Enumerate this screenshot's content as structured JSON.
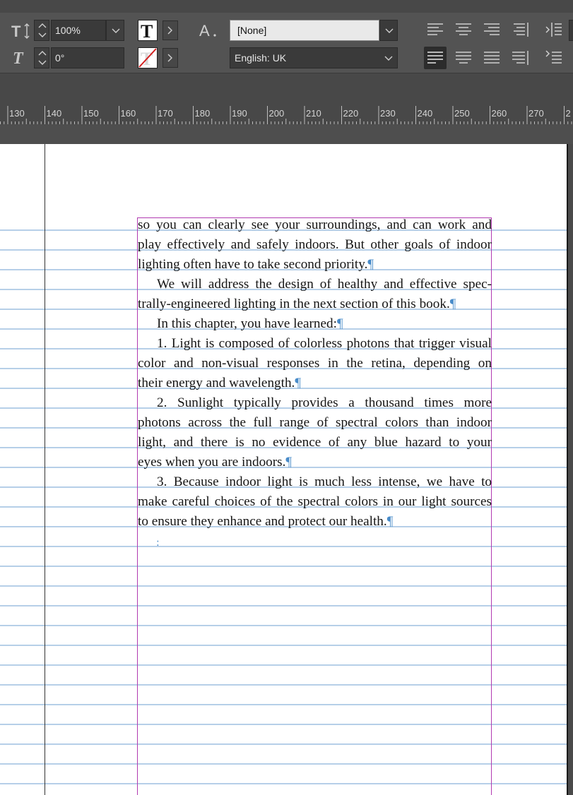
{
  "toolbar": {
    "horizontal_scale": "100%",
    "skew": "0°",
    "character_style": "[None]",
    "language": "English: UK"
  },
  "ruler": {
    "labels": [
      "130",
      "140",
      "150",
      "160",
      "170",
      "180",
      "190",
      "200",
      "210",
      "220",
      "230",
      "240",
      "250",
      "260",
      "270",
      "2"
    ]
  },
  "document": {
    "lines": [
      "so you can clearly see your surroundings, and can work and",
      "play effectively and safely indoors. But other goals of indoor",
      "lighting often have to take second priority.",
      "We will address the design of healthy and effective spec-",
      "trally-engineered lighting in the next section of this book.",
      "In this chapter, you have learned:",
      "1. Light is composed of colorless photons that trigger visual",
      "color and non-visual responses in the retina, depending on",
      "their energy and wavelength.",
      "2. Sunlight typically provides a thousand times more",
      "photons across the full range of spectral colors than indoor",
      "light, and there is no evidence of any blue hazard to your",
      "eyes when you are indoors.",
      "3. Because indoor light is much less intense, we have to",
      "make careful choices of the spectral colors in our light sources",
      "to ensure they enhance and protect our health."
    ],
    "pilcrow": "¶",
    "end_marker": ":"
  }
}
